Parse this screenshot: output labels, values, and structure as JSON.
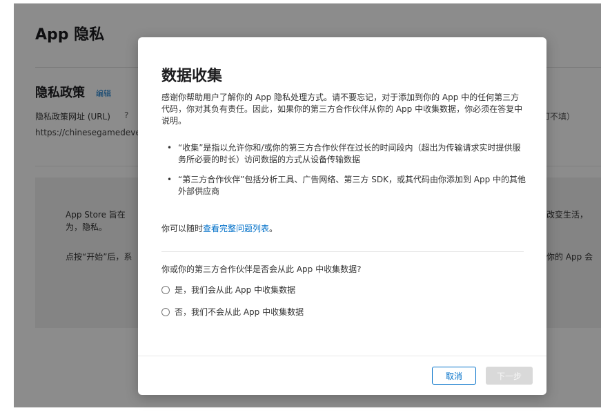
{
  "background": {
    "page_title": "App 隐私",
    "policy_heading": "隐私政策",
    "edit_link": "编辑",
    "url_label": "隐私政策网址 (URL)",
    "help_icon": "question-mark",
    "url_value": "https://chinesegamedeve",
    "optional_note": "可不填）",
    "panel_text1": "App Store 旨在为，隐私。",
    "panel_text2": "点按“开始”后，系",
    "panel_right1": "改变生活，",
    "panel_right2": "你的 App 会"
  },
  "modal": {
    "title": "数据收集",
    "intro": "感谢你帮助用户了解你的 App 隐私处理方式。请不要忘记，对于添加到你的 App 中的任何第三方代码，你对其负有责任。因此，如果你的第三方合作伙伴从你的 App 中收集数据，你必须在答复中说明。",
    "bullets": [
      "“收集”是指以允许你和/或你的第三方合作伙伴在过长的时间段内（超出为传输请求实时提供服务所必要的时长）访问数据的方式从设备传输数据",
      "“第三方合作伙伴”包括分析工具、广告网络、第三方 SDK，或其代码由你添加到 App 中的其他外部供应商"
    ],
    "more_prefix": "你可以随时",
    "more_link": "查看完整问题列表",
    "more_suffix": "。",
    "question": "你或你的第三方合作伙伴是否会从此 App 中收集数据?",
    "option_yes": "是，我们会从此 App 中收集数据",
    "option_no": "否，我们不会从此 App 中收集数据",
    "cancel_label": "取消",
    "next_label": "下一步"
  },
  "colors": {
    "accent": "#0070c9",
    "disabled_button": "#d9d9d9"
  }
}
